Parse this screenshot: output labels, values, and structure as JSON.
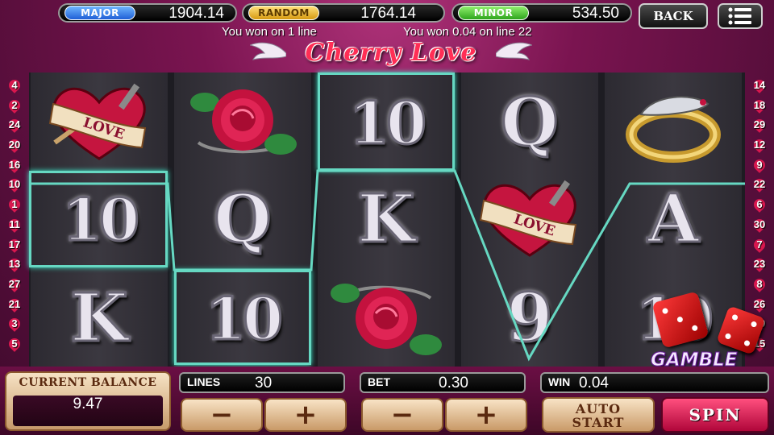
{
  "jackpots": [
    {
      "label": "MAJOR",
      "value": "1904.14"
    },
    {
      "label": "RANDOM",
      "value": "1764.14"
    },
    {
      "label": "MINOR",
      "value": "534.50"
    }
  ],
  "header": {
    "back_label": "BACK",
    "menu_icon": "hamburger-menu-icon",
    "win_message_left": "You won on 1 line",
    "win_message_right": "You won 0.04 on line 22"
  },
  "logo": {
    "title": "Cherry Love"
  },
  "paylines": {
    "left": [
      "4",
      "2",
      "24",
      "20",
      "16",
      "10",
      "1",
      "11",
      "17",
      "13",
      "27",
      "21",
      "3",
      "5"
    ],
    "right": [
      "14",
      "18",
      "29",
      "12",
      "9",
      "22",
      "6",
      "30",
      "7",
      "23",
      "8",
      "26",
      "19",
      "15"
    ]
  },
  "reels": [
    [
      "heart-love",
      "10",
      "K"
    ],
    [
      "rose",
      "Q",
      "10"
    ],
    [
      "10",
      "K",
      "rose"
    ],
    [
      "Q",
      "heart-love",
      "9"
    ],
    [
      "ring",
      "A",
      "10"
    ]
  ],
  "symbol_text": {
    "heart_banner": "LOVE"
  },
  "winning_line": 22,
  "winning_cells": [
    [
      0,
      1
    ],
    [
      1,
      2
    ],
    [
      2,
      0
    ]
  ],
  "controls": {
    "balance_label": "CURRENT BALANCE",
    "balance_value": "9.47",
    "lines_label": "LINES",
    "lines_value": "30",
    "bet_label": "BET",
    "bet_value": "0.30",
    "win_label": "WIN",
    "win_value": "0.04",
    "minus": "−",
    "plus": "+",
    "auto_start_line1": "AUTO",
    "auto_start_line2": "START",
    "spin_label": "SPIN",
    "gamble_label": "GAMBLE"
  },
  "colors": {
    "win_line": "#66d8c2",
    "accent": "#d8174e"
  }
}
